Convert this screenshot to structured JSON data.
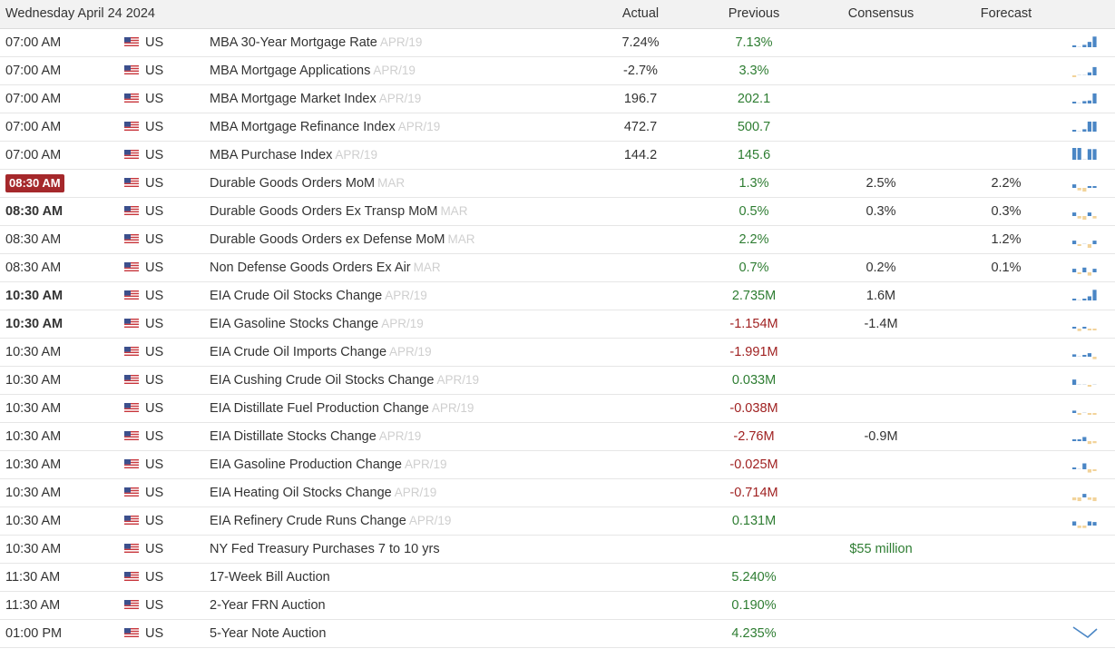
{
  "header": {
    "date": "Wednesday April 24 2024",
    "actual": "Actual",
    "previous": "Previous",
    "consensus": "Consensus",
    "forecast": "Forecast"
  },
  "colors": {
    "positive": "#2e7d32",
    "negative": "#a02222",
    "highlight_time": "#a5282b",
    "spark_blue": "#4a86c5",
    "spark_orange": "#f2d39a"
  },
  "rows": [
    {
      "time": "07:00 AM",
      "country": "US",
      "event": "MBA 30-Year Mortgage Rate",
      "period": "APR/19",
      "actual": "7.24%",
      "previous": "7.13%",
      "prev_dir": "pos",
      "consensus": "",
      "forecast": "",
      "spark": [
        [
          1,
          0.15
        ],
        [
          0,
          0
        ],
        [
          1,
          0.2
        ],
        [
          1,
          0.45
        ],
        [
          1,
          0.9
        ]
      ]
    },
    {
      "time": "07:00 AM",
      "country": "US",
      "event": "MBA Mortgage Applications",
      "period": "APR/19",
      "actual": "-2.7%",
      "previous": "3.3%",
      "prev_dir": "pos",
      "consensus": "",
      "forecast": "",
      "spark": [
        [
          -1,
          0.1
        ],
        [
          0,
          0
        ],
        [
          0,
          0
        ],
        [
          1,
          0.25
        ],
        [
          1,
          0.7
        ]
      ]
    },
    {
      "time": "07:00 AM",
      "country": "US",
      "event": "MBA Mortgage Market Index",
      "period": "APR/19",
      "actual": "196.7",
      "previous": "202.1",
      "prev_dir": "pos",
      "consensus": "",
      "forecast": "",
      "spark": [
        [
          1,
          0.15
        ],
        [
          0,
          0
        ],
        [
          1,
          0.2
        ],
        [
          1,
          0.25
        ],
        [
          1,
          0.85
        ]
      ]
    },
    {
      "time": "07:00 AM",
      "country": "US",
      "event": "MBA Mortgage Refinance Index",
      "period": "APR/19",
      "actual": "472.7",
      "previous": "500.7",
      "prev_dir": "pos",
      "consensus": "",
      "forecast": "",
      "spark": [
        [
          1,
          0.15
        ],
        [
          0,
          0
        ],
        [
          1,
          0.2
        ],
        [
          1,
          0.85
        ],
        [
          1,
          0.85
        ]
      ]
    },
    {
      "time": "07:00 AM",
      "country": "US",
      "event": "MBA Purchase Index",
      "period": "APR/19",
      "actual": "144.2",
      "previous": "145.6",
      "prev_dir": "pos",
      "consensus": "",
      "forecast": "",
      "spark": [
        [
          1,
          1
        ],
        [
          1,
          1
        ],
        [
          0,
          0
        ],
        [
          1,
          0.9
        ],
        [
          1,
          0.9
        ]
      ]
    },
    {
      "time": "08:30 AM",
      "time_badge": true,
      "country": "US",
      "event": "Durable Goods Orders MoM",
      "period": "MAR",
      "actual": "",
      "previous": "1.3%",
      "prev_dir": "pos",
      "consensus": "2.5%",
      "forecast": "2.2%",
      "spark": [
        [
          1,
          0.3
        ],
        [
          -1,
          0.3
        ],
        [
          -1,
          0.45
        ],
        [
          1,
          0.1
        ],
        [
          1,
          0.1
        ]
      ]
    },
    {
      "time": "08:30 AM",
      "bold": true,
      "country": "US",
      "event": "Durable Goods Orders Ex Transp MoM",
      "period": "MAR",
      "actual": "",
      "previous": "0.5%",
      "prev_dir": "pos",
      "consensus": "0.3%",
      "forecast": "0.3%",
      "spark": [
        [
          1,
          0.3
        ],
        [
          -1,
          0.3
        ],
        [
          -1,
          0.45
        ],
        [
          1,
          0.3
        ],
        [
          -1,
          0.3
        ]
      ]
    },
    {
      "time": "08:30 AM",
      "country": "US",
      "event": "Durable Goods Orders ex Defense MoM",
      "period": "MAR",
      "actual": "",
      "previous": "2.2%",
      "prev_dir": "pos",
      "consensus": "",
      "forecast": "1.2%",
      "spark": [
        [
          1,
          0.3
        ],
        [
          -1,
          0.2
        ],
        [
          0,
          0
        ],
        [
          -1,
          0.45
        ],
        [
          1,
          0.3
        ]
      ]
    },
    {
      "time": "08:30 AM",
      "country": "US",
      "event": "Non Defense Goods Orders Ex Air",
      "period": "MAR",
      "actual": "",
      "previous": "0.7%",
      "prev_dir": "pos",
      "consensus": "0.2%",
      "forecast": "0.1%",
      "spark": [
        [
          1,
          0.3
        ],
        [
          -1,
          0.2
        ],
        [
          1,
          0.4
        ],
        [
          -1,
          0.4
        ],
        [
          1,
          0.3
        ]
      ]
    },
    {
      "time": "10:30 AM",
      "bold": true,
      "country": "US",
      "event": "EIA Crude Oil Stocks Change",
      "period": "APR/19",
      "actual": "",
      "previous": "2.735M",
      "prev_dir": "pos",
      "consensus": "1.6M",
      "forecast": "",
      "spark": [
        [
          1,
          0.15
        ],
        [
          0,
          0
        ],
        [
          1,
          0.15
        ],
        [
          1,
          0.35
        ],
        [
          1,
          0.9
        ]
      ]
    },
    {
      "time": "10:30 AM",
      "bold": true,
      "country": "US",
      "event": "EIA Gasoline Stocks Change",
      "period": "APR/19",
      "actual": "",
      "previous": "-1.154M",
      "prev_dir": "neg",
      "consensus": "-1.4M",
      "forecast": "",
      "spark": [
        [
          1,
          0.1
        ],
        [
          -1,
          0.3
        ],
        [
          1,
          0.1
        ],
        [
          -1,
          0.15
        ],
        [
          -1,
          0.15
        ]
      ]
    },
    {
      "time": "10:30 AM",
      "country": "US",
      "event": "EIA Crude Oil Imports Change",
      "period": "APR/19",
      "actual": "",
      "previous": "-1.991M",
      "prev_dir": "neg",
      "consensus": "",
      "forecast": "",
      "spark": [
        [
          1,
          0.2
        ],
        [
          0,
          0
        ],
        [
          1,
          0.15
        ],
        [
          1,
          0.3
        ],
        [
          -1,
          0.3
        ]
      ]
    },
    {
      "time": "10:30 AM",
      "country": "US",
      "event": "EIA Cushing Crude Oil Stocks Change",
      "period": "APR/19",
      "actual": "",
      "previous": "0.033M",
      "prev_dir": "pos",
      "consensus": "",
      "forecast": "",
      "spark": [
        [
          1,
          0.45
        ],
        [
          0,
          0
        ],
        [
          0,
          0
        ],
        [
          -1,
          0.05
        ],
        [
          0,
          0
        ]
      ]
    },
    {
      "time": "10:30 AM",
      "country": "US",
      "event": "EIA Distillate Fuel Production Change",
      "period": "APR/19",
      "actual": "",
      "previous": "-0.038M",
      "prev_dir": "neg",
      "consensus": "",
      "forecast": "",
      "spark": [
        [
          1,
          0.2
        ],
        [
          -1,
          0.15
        ],
        [
          0,
          0
        ],
        [
          -1,
          0.1
        ],
        [
          -1,
          0.1
        ]
      ]
    },
    {
      "time": "10:30 AM",
      "country": "US",
      "event": "EIA Distillate Stocks Change",
      "period": "APR/19",
      "actual": "",
      "previous": "-2.76M",
      "prev_dir": "neg",
      "consensus": "-0.9M",
      "forecast": "",
      "spark": [
        [
          1,
          0.15
        ],
        [
          1,
          0.15
        ],
        [
          1,
          0.35
        ],
        [
          -1,
          0.35
        ],
        [
          -1,
          0.25
        ]
      ]
    },
    {
      "time": "10:30 AM",
      "country": "US",
      "event": "EIA Gasoline Production Change",
      "period": "APR/19",
      "actual": "",
      "previous": "-0.025M",
      "prev_dir": "neg",
      "consensus": "",
      "forecast": "",
      "spark": [
        [
          1,
          0.1
        ],
        [
          0,
          0
        ],
        [
          1,
          0.5
        ],
        [
          -1,
          0.4
        ],
        [
          -1,
          0.2
        ]
      ]
    },
    {
      "time": "10:30 AM",
      "country": "US",
      "event": "EIA Heating Oil Stocks Change",
      "period": "APR/19",
      "actual": "",
      "previous": "-0.714M",
      "prev_dir": "neg",
      "consensus": "",
      "forecast": "",
      "spark": [
        [
          -1,
          0.35
        ],
        [
          -1,
          0.45
        ],
        [
          1,
          0.3
        ],
        [
          -1,
          0.3
        ],
        [
          -1,
          0.45
        ]
      ]
    },
    {
      "time": "10:30 AM",
      "country": "US",
      "event": "EIA Refinery Crude Runs Change",
      "period": "APR/19",
      "actual": "",
      "previous": "0.131M",
      "prev_dir": "pos",
      "consensus": "",
      "forecast": "",
      "spark": [
        [
          1,
          0.35
        ],
        [
          -1,
          0.3
        ],
        [
          -1,
          0.3
        ],
        [
          1,
          0.35
        ],
        [
          1,
          0.3
        ]
      ]
    },
    {
      "time": "10:30 AM",
      "country": "US",
      "event": "NY Fed Treasury Purchases 7 to 10 yrs",
      "period": "",
      "actual": "",
      "previous": "",
      "prev_dir": "pos",
      "consensus": "$55 million",
      "consensus_dir": "pos",
      "forecast": "",
      "spark": null
    },
    {
      "time": "11:30 AM",
      "country": "US",
      "event": "17-Week Bill Auction",
      "period": "",
      "actual": "",
      "previous": "5.240%",
      "prev_dir": "pos",
      "consensus": "",
      "forecast": "",
      "spark": null
    },
    {
      "time": "11:30 AM",
      "country": "US",
      "event": "2-Year FRN Auction",
      "period": "",
      "actual": "",
      "previous": "0.190%",
      "prev_dir": "pos",
      "consensus": "",
      "forecast": "",
      "spark": null
    },
    {
      "time": "01:00 PM",
      "country": "US",
      "event": "5-Year Note Auction",
      "period": "",
      "actual": "",
      "previous": "4.235%",
      "prev_dir": "pos",
      "consensus": "",
      "forecast": "",
      "spark": "line-down"
    }
  ]
}
